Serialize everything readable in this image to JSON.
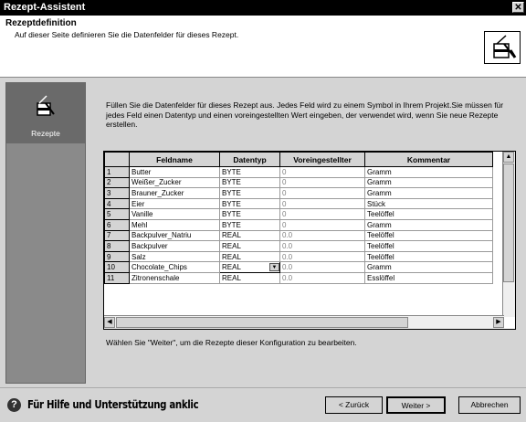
{
  "window": {
    "title": "Rezept-Assistent"
  },
  "header": {
    "title": "Rezeptdefinition",
    "subtitle": "Auf dieser Seite definieren Sie die Datenfelder für dieses Rezept."
  },
  "sidebar": {
    "item_label": "Rezepte"
  },
  "intro": "Füllen Sie die Datenfelder für dieses Rezept aus. Jedes Feld wird zu einem Symbol in Ihrem Projekt.Sie müssen für jedes Feld einen Datentyp und einen voreingestellten Wert eingeben, der verwendet wird, wenn Sie neue Rezepte erstellen.",
  "table": {
    "columns": [
      "Feldname",
      "Datentyp",
      "Voreingestellter",
      "Kommentar"
    ],
    "rows": [
      [
        "1",
        "Butter",
        "BYTE",
        "0",
        "Gramm"
      ],
      [
        "2",
        "Weißer_Zucker",
        "BYTE",
        "0",
        "Gramm"
      ],
      [
        "3",
        "Brauner_Zucker",
        "BYTE",
        "0",
        "Gramm"
      ],
      [
        "4",
        "Eier",
        "BYTE",
        "0",
        "Stück"
      ],
      [
        "5",
        "Vanille",
        "BYTE",
        "0",
        "Teelöffel"
      ],
      [
        "6",
        "Mehl",
        "BYTE",
        "0",
        "Gramm"
      ],
      [
        "7",
        "Backpulver_Natriu",
        "REAL",
        "0.0",
        "Teelöffel"
      ],
      [
        "8",
        "Backpulver",
        "REAL",
        "0.0",
        "Teelöffel"
      ],
      [
        "9",
        "Salz",
        "REAL",
        "0.0",
        "Teelöffel"
      ],
      [
        "10",
        "Chocolate_Chips",
        "REAL",
        "0.0",
        "Gramm"
      ],
      [
        "11",
        "Zitronenschale",
        "REAL",
        "0.0",
        "Esslöffel"
      ]
    ]
  },
  "hint": "Wählen Sie \"Weiter\", um die Rezepte dieser Konfiguration zu bearbeiten.",
  "footer": {
    "help_text": "Für Hilfe und Unterstützung anklic",
    "back_label": "< Zurück",
    "next_label": "Weiter >",
    "cancel_label": "Abbrechen"
  }
}
